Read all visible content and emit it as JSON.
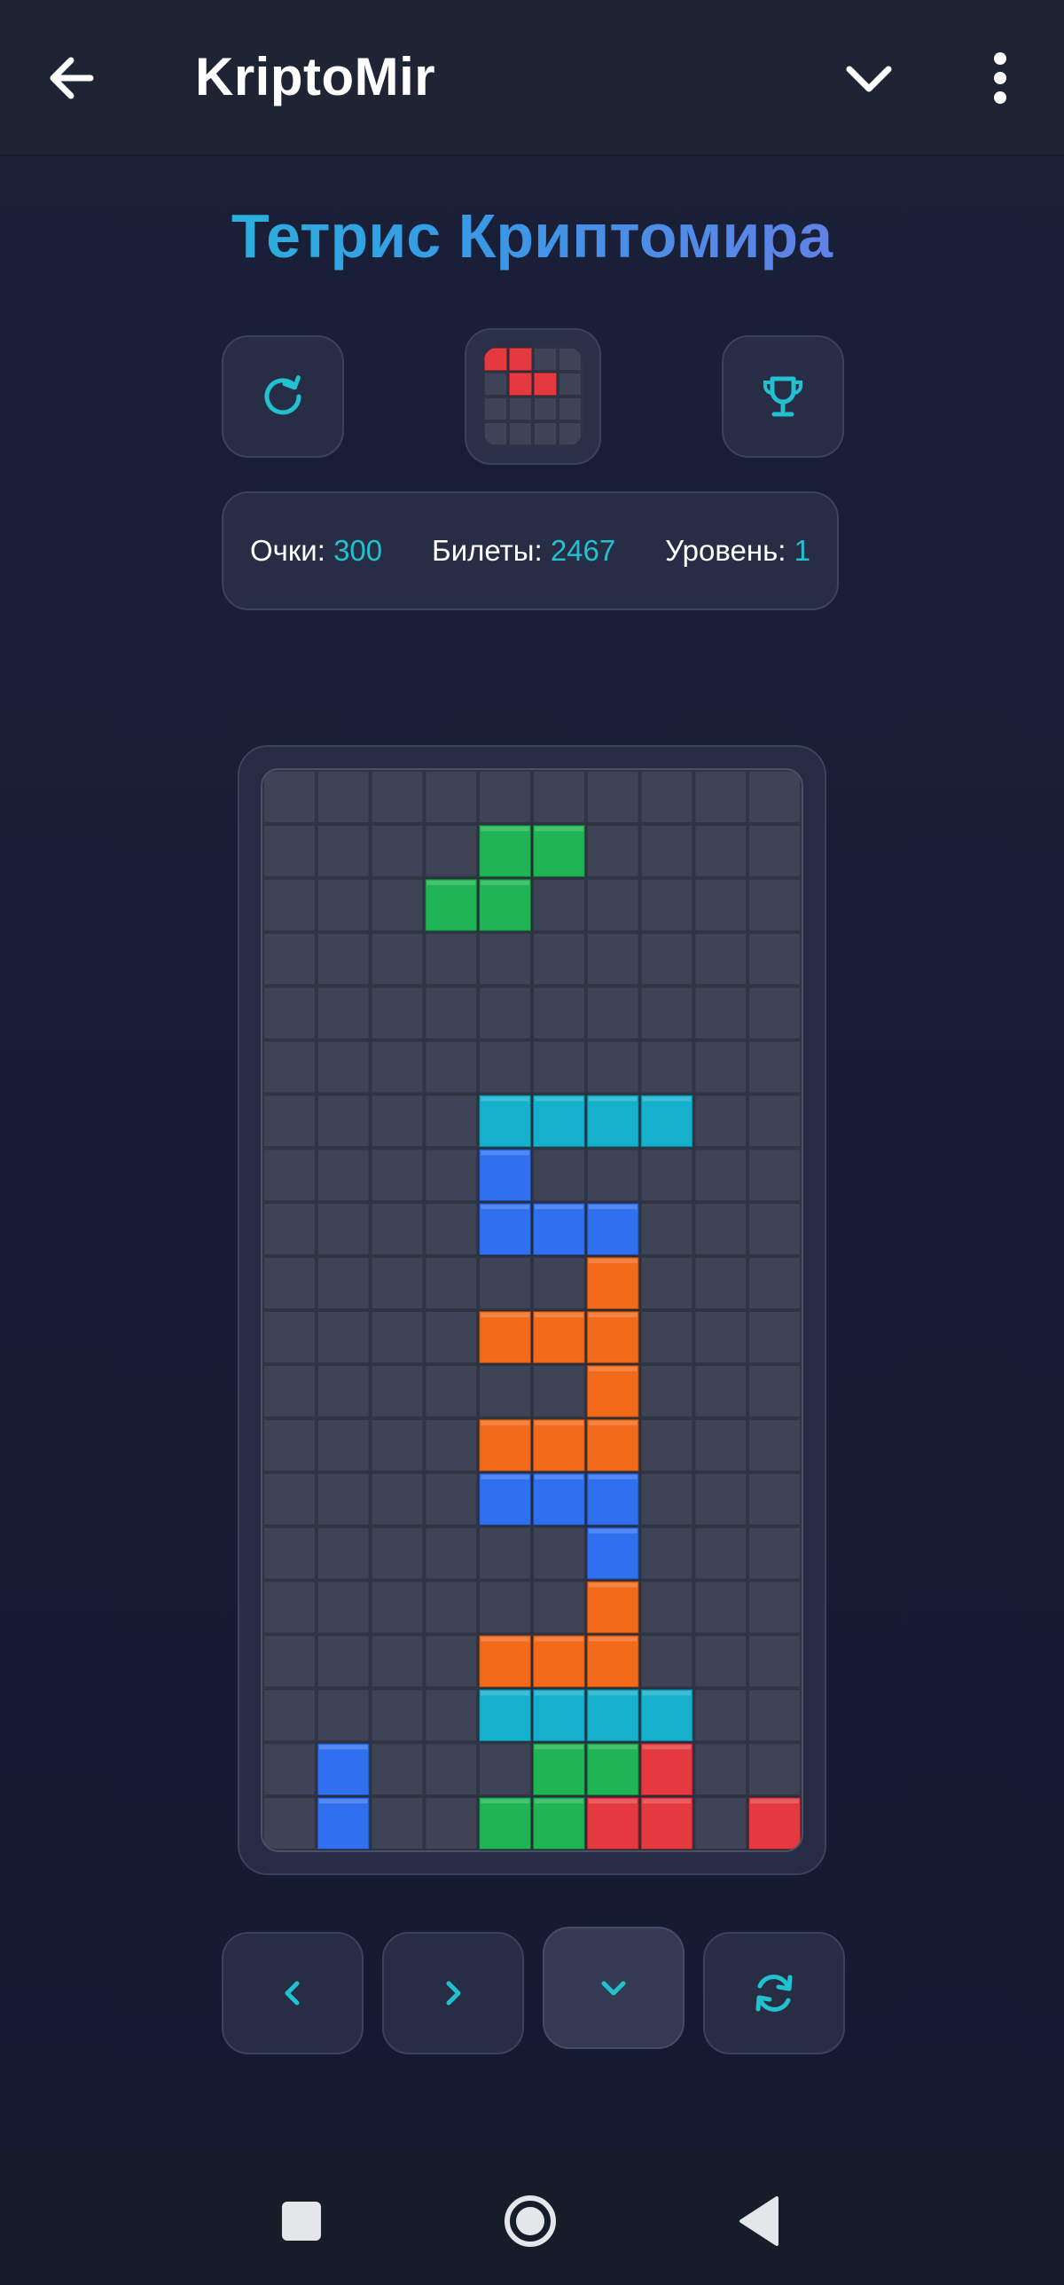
{
  "app": {
    "title": "KriptoMir"
  },
  "header_icons": {
    "back": "arrow-left-icon",
    "dropdown": "chevron-down-icon",
    "menu": "more-vertical-icon"
  },
  "game": {
    "title": "Тетрис Криптомира",
    "buttons": {
      "restart": "refresh-icon",
      "leaderboard": "trophy-icon"
    },
    "next_piece": {
      "shape": "Z",
      "color": "#e53940",
      "cells": [
        [
          0,
          0
        ],
        [
          0,
          1
        ],
        [
          1,
          1
        ],
        [
          1,
          2
        ]
      ]
    },
    "stats": {
      "score_label": "Очки:",
      "score_value": "300",
      "tickets_label": "Билеты:",
      "tickets_value": "2467",
      "level_label": "Уровень:",
      "level_value": "1"
    },
    "colors": {
      "S": "#1fb454",
      "I": "#14b0cc",
      "J": "#2f6ff0",
      "L": "#f26a1a",
      "Z": "#e53940",
      "empty": "#3e4456",
      "grid": "#2f3444",
      "accent": "#22c1cf"
    },
    "board": {
      "cols": 10,
      "rows": 20,
      "cells": [
        "..........",
        "....SS....",
        "...SS.....",
        "..........",
        "..........",
        "..........",
        "....IIII..",
        "....J.....",
        "....JJJ...",
        "......L...",
        "....LLL...",
        "......L...",
        "....LLL...",
        "....JJJ...",
        "......J...",
        "......L...",
        "....LLL...",
        "....IIII..",
        ".J...SSZ..",
        ".J..SSZZ.Z"
      ]
    },
    "controls": {
      "left": "chevron-left-icon",
      "right": "chevron-right-icon",
      "down": "chevron-down-icon",
      "rotate": "rotate-icon"
    }
  },
  "system_nav": {
    "recents": "square-icon",
    "home": "circle-icon",
    "back": "triangle-back-icon"
  }
}
